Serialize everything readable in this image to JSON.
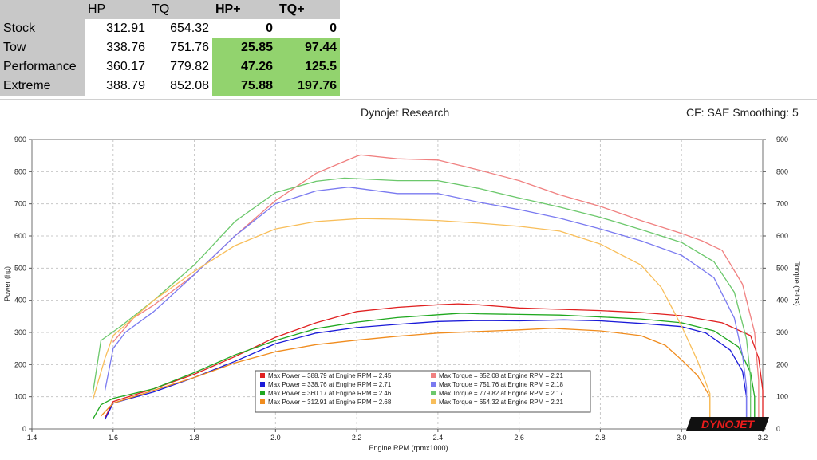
{
  "table": {
    "headers": [
      "",
      "HP",
      "TQ",
      "HP+",
      "TQ+"
    ],
    "rows": [
      {
        "name": "Stock",
        "hp": "312.91",
        "tq": "654.32",
        "hp_plus": "0",
        "tq_plus": "0"
      },
      {
        "name": "Tow",
        "hp": "338.76",
        "tq": "751.76",
        "hp_plus": "25.85",
        "tq_plus": "97.44"
      },
      {
        "name": "Performance",
        "hp": "360.17",
        "tq": "779.82",
        "hp_plus": "47.26",
        "tq_plus": "125.5"
      },
      {
        "name": "Extreme",
        "hp": "388.79",
        "tq": "852.08",
        "hp_plus": "75.88",
        "tq_plus": "197.76"
      }
    ],
    "highlight_color": "#92d36e"
  },
  "dyno": {
    "title": "Dynojet Research",
    "right_info": "CF: SAE Smoothing: 5",
    "logo": "DYNOJET"
  },
  "chart_data": {
    "type": "line",
    "xlabel": "Engine RPM (rpmx1000)",
    "ylabel": "Power (hp)",
    "y2label": "Torque (ft-lbs)",
    "xlim": [
      1.4,
      3.2
    ],
    "ylim": [
      0,
      900
    ],
    "x_ticks": [
      "1.4",
      "1.6",
      "1.8",
      "2.0",
      "2.2",
      "2.4",
      "2.6",
      "2.8",
      "3.0",
      "3.2"
    ],
    "y_ticks": [
      "0",
      "100",
      "200",
      "300",
      "400",
      "500",
      "600",
      "700",
      "800",
      "900"
    ],
    "y2_ticks": [
      "0",
      "100",
      "200",
      "300",
      "400",
      "500",
      "600",
      "700",
      "800",
      "900"
    ],
    "grid": true,
    "legend": [
      {
        "label": "Max Power = 388.79 at Engine RPM = 2.45",
        "color": "#e02020"
      },
      {
        "label": "Max Power = 338.76 at Engine RPM = 2.71",
        "color": "#1a1ad8"
      },
      {
        "label": "Max Power = 360.17 at Engine RPM = 2.46",
        "color": "#1fa81f"
      },
      {
        "label": "Max Power = 312.91 at Engine RPM = 2.68",
        "color": "#f08c1e"
      },
      {
        "label": "Max Torque = 852.08 at Engine RPM = 2.21",
        "color": "#f08080"
      },
      {
        "label": "Max Torque = 751.76 at Engine RPM = 2.18",
        "color": "#7a7af0"
      },
      {
        "label": "Max Torque = 779.82 at Engine RPM = 2.17",
        "color": "#6cc86c"
      },
      {
        "label": "Max Torque = 654.32 at Engine RPM = 2.21",
        "color": "#f8be5a"
      }
    ],
    "series": [
      {
        "kind": "power",
        "color": "#e02020",
        "points": [
          [
            1.58,
            35
          ],
          [
            1.6,
            85
          ],
          [
            1.7,
            125
          ],
          [
            1.8,
            170
          ],
          [
            1.9,
            225
          ],
          [
            2.0,
            285
          ],
          [
            2.1,
            330
          ],
          [
            2.2,
            365
          ],
          [
            2.3,
            378
          ],
          [
            2.4,
            386
          ],
          [
            2.45,
            389
          ],
          [
            2.5,
            386
          ],
          [
            2.6,
            376
          ],
          [
            2.7,
            372
          ],
          [
            2.8,
            368
          ],
          [
            2.9,
            362
          ],
          [
            3.0,
            352
          ],
          [
            3.1,
            330
          ],
          [
            3.17,
            290
          ],
          [
            3.19,
            220
          ],
          [
            3.2,
            120
          ],
          [
            3.2,
            30
          ]
        ]
      },
      {
        "kind": "power",
        "color": "#1a1ad8",
        "points": [
          [
            1.58,
            30
          ],
          [
            1.6,
            80
          ],
          [
            1.7,
            115
          ],
          [
            1.8,
            160
          ],
          [
            1.9,
            210
          ],
          [
            2.0,
            265
          ],
          [
            2.1,
            298
          ],
          [
            2.2,
            315
          ],
          [
            2.3,
            325
          ],
          [
            2.4,
            334
          ],
          [
            2.5,
            337
          ],
          [
            2.6,
            336
          ],
          [
            2.71,
            339
          ],
          [
            2.8,
            336
          ],
          [
            2.9,
            328
          ],
          [
            3.0,
            318
          ],
          [
            3.06,
            298
          ],
          [
            3.12,
            245
          ],
          [
            3.15,
            180
          ],
          [
            3.16,
            100
          ],
          [
            3.16,
            30
          ]
        ]
      },
      {
        "kind": "power",
        "color": "#1fa81f",
        "points": [
          [
            1.55,
            30
          ],
          [
            1.57,
            75
          ],
          [
            1.6,
            95
          ],
          [
            1.7,
            125
          ],
          [
            1.8,
            175
          ],
          [
            1.9,
            230
          ],
          [
            2.0,
            275
          ],
          [
            2.1,
            312
          ],
          [
            2.2,
            332
          ],
          [
            2.3,
            346
          ],
          [
            2.4,
            355
          ],
          [
            2.46,
            360
          ],
          [
            2.5,
            358
          ],
          [
            2.6,
            356
          ],
          [
            2.7,
            354
          ],
          [
            2.8,
            348
          ],
          [
            2.9,
            342
          ],
          [
            3.0,
            330
          ],
          [
            3.08,
            305
          ],
          [
            3.14,
            255
          ],
          [
            3.17,
            175
          ],
          [
            3.18,
            100
          ],
          [
            3.18,
            30
          ]
        ]
      },
      {
        "kind": "power",
        "color": "#f08c1e",
        "points": [
          [
            1.57,
            40
          ],
          [
            1.6,
            80
          ],
          [
            1.7,
            120
          ],
          [
            1.8,
            160
          ],
          [
            1.9,
            205
          ],
          [
            2.0,
            240
          ],
          [
            2.1,
            262
          ],
          [
            2.2,
            276
          ],
          [
            2.3,
            288
          ],
          [
            2.4,
            298
          ],
          [
            2.5,
            303
          ],
          [
            2.6,
            308
          ],
          [
            2.68,
            313
          ],
          [
            2.8,
            305
          ],
          [
            2.9,
            290
          ],
          [
            2.96,
            260
          ],
          [
            3.0,
            215
          ],
          [
            3.04,
            165
          ],
          [
            3.07,
            100
          ],
          [
            3.07,
            20
          ]
        ]
      },
      {
        "kind": "torque",
        "color": "#f08080",
        "points": [
          [
            1.6,
            270
          ],
          [
            1.65,
            345
          ],
          [
            1.7,
            385
          ],
          [
            1.8,
            480
          ],
          [
            1.9,
            600
          ],
          [
            2.0,
            710
          ],
          [
            2.1,
            795
          ],
          [
            2.2,
            848
          ],
          [
            2.21,
            852
          ],
          [
            2.3,
            840
          ],
          [
            2.4,
            836
          ],
          [
            2.5,
            805
          ],
          [
            2.6,
            772
          ],
          [
            2.7,
            728
          ],
          [
            2.8,
            692
          ],
          [
            2.9,
            648
          ],
          [
            3.0,
            608
          ],
          [
            3.05,
            585
          ],
          [
            3.1,
            555
          ],
          [
            3.15,
            450
          ],
          [
            3.18,
            300
          ],
          [
            3.19,
            150
          ],
          [
            3.19,
            30
          ]
        ]
      },
      {
        "kind": "torque",
        "color": "#7a7af0",
        "points": [
          [
            1.58,
            120
          ],
          [
            1.6,
            250
          ],
          [
            1.63,
            300
          ],
          [
            1.7,
            365
          ],
          [
            1.8,
            480
          ],
          [
            1.9,
            600
          ],
          [
            2.0,
            700
          ],
          [
            2.1,
            740
          ],
          [
            2.18,
            752
          ],
          [
            2.3,
            732
          ],
          [
            2.4,
            732
          ],
          [
            2.5,
            705
          ],
          [
            2.6,
            682
          ],
          [
            2.7,
            655
          ],
          [
            2.8,
            622
          ],
          [
            2.9,
            585
          ],
          [
            3.0,
            540
          ],
          [
            3.08,
            470
          ],
          [
            3.13,
            345
          ],
          [
            3.15,
            230
          ],
          [
            3.16,
            130
          ],
          [
            3.16,
            30
          ]
        ]
      },
      {
        "kind": "torque",
        "color": "#6cc86c",
        "points": [
          [
            1.55,
            110
          ],
          [
            1.57,
            275
          ],
          [
            1.62,
            320
          ],
          [
            1.7,
            400
          ],
          [
            1.8,
            510
          ],
          [
            1.9,
            645
          ],
          [
            2.0,
            735
          ],
          [
            2.1,
            770
          ],
          [
            2.17,
            780
          ],
          [
            2.3,
            772
          ],
          [
            2.4,
            772
          ],
          [
            2.5,
            748
          ],
          [
            2.6,
            718
          ],
          [
            2.7,
            690
          ],
          [
            2.8,
            658
          ],
          [
            2.9,
            620
          ],
          [
            3.0,
            580
          ],
          [
            3.08,
            520
          ],
          [
            3.13,
            425
          ],
          [
            3.16,
            280
          ],
          [
            3.17,
            160
          ],
          [
            3.17,
            30
          ]
        ]
      },
      {
        "kind": "torque",
        "color": "#f8be5a",
        "points": [
          [
            1.55,
            90
          ],
          [
            1.58,
            220
          ],
          [
            1.6,
            290
          ],
          [
            1.7,
            400
          ],
          [
            1.8,
            490
          ],
          [
            1.9,
            570
          ],
          [
            2.0,
            622
          ],
          [
            2.1,
            645
          ],
          [
            2.21,
            654
          ],
          [
            2.3,
            652
          ],
          [
            2.4,
            648
          ],
          [
            2.5,
            640
          ],
          [
            2.6,
            630
          ],
          [
            2.7,
            615
          ],
          [
            2.8,
            575
          ],
          [
            2.9,
            510
          ],
          [
            2.95,
            440
          ],
          [
            3.0,
            320
          ],
          [
            3.04,
            210
          ],
          [
            3.07,
            110
          ],
          [
            3.07,
            30
          ]
        ]
      }
    ]
  }
}
